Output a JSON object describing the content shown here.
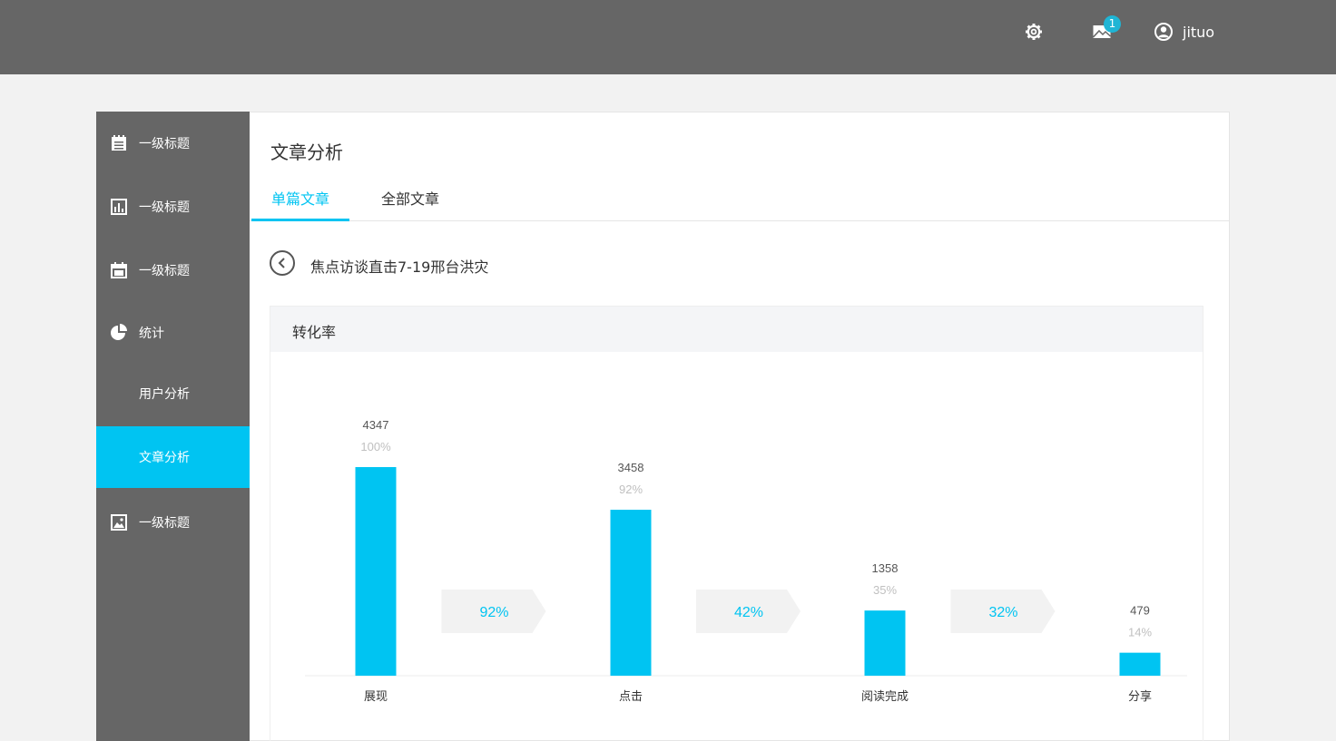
{
  "header": {
    "mail_badge": "1",
    "username": "jituo",
    "icons": [
      "gear-icon",
      "mail-icon",
      "user-circle-icon"
    ]
  },
  "sidebar": {
    "items": [
      {
        "label": "一级标题",
        "icon": "notepad-icon"
      },
      {
        "label": "一级标题",
        "icon": "bar-chart-icon"
      },
      {
        "label": "一级标题",
        "icon": "calendar-icon"
      },
      {
        "label": "统计",
        "icon": "pie-chart-icon"
      },
      {
        "label": "用户分析"
      },
      {
        "label": "文章分析",
        "active": true
      },
      {
        "label": "一级标题",
        "icon": "image-icon"
      }
    ],
    "active_color": "#00c4f2"
  },
  "main": {
    "title": "文章分析",
    "tabs": [
      {
        "label": "单篇文章",
        "active": true
      },
      {
        "label": "全部文章"
      }
    ],
    "article_title": "焦点访谈直击7-19邢台洪灾",
    "panel_title": "转化率"
  },
  "chart_data": {
    "type": "bar",
    "categories": [
      "展现",
      "点击",
      "阅读完成",
      "分享"
    ],
    "values": [
      4347,
      3458,
      1358,
      479
    ],
    "percent_labels": [
      "100%",
      "92%",
      "35%",
      "14%"
    ],
    "conversion_rates": [
      "92%",
      "42%",
      "32%"
    ],
    "bar_color": "#00c4f2",
    "grid": false
  }
}
